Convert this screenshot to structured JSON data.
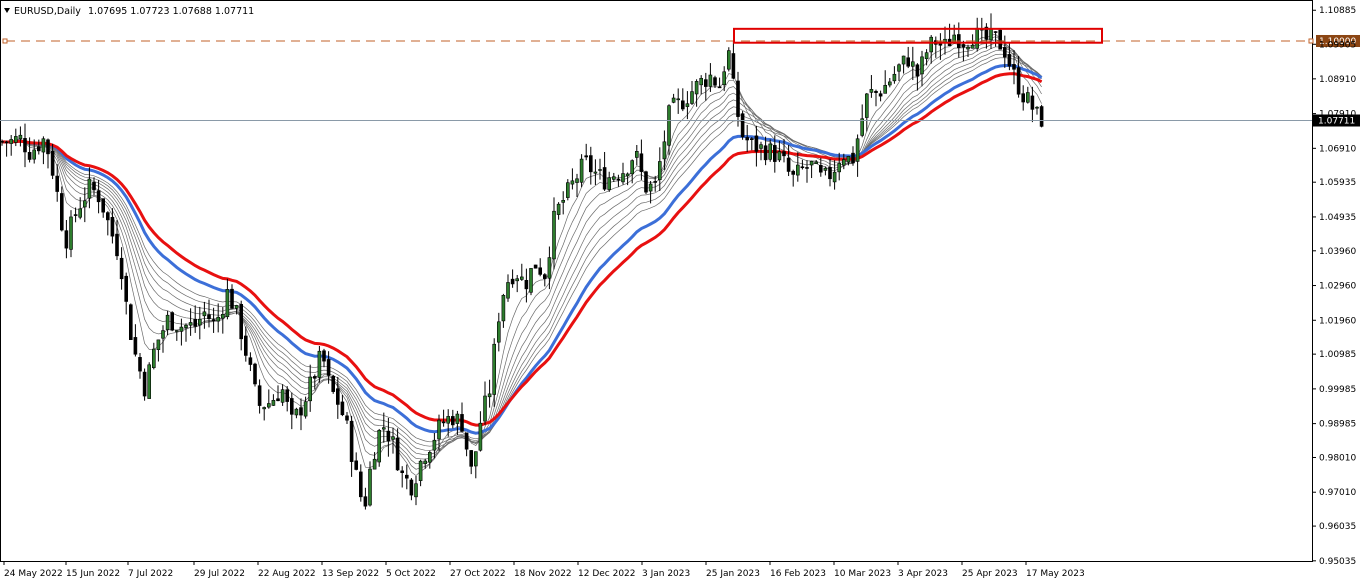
{
  "header": {
    "symbol_timeframe": "EURUSD,Daily",
    "ohlc": "1.07695 1.07723 1.07688 1.07711",
    "menu_icon": "triangle-down-icon"
  },
  "chart_data": {
    "type": "candlestick",
    "title": "EURUSD,Daily",
    "y_ticks": [
      "1.10885",
      "1.09905",
      "1.08910",
      "1.07910",
      "1.06910",
      "1.05935",
      "1.04935",
      "1.03960",
      "1.02960",
      "1.01960",
      "1.00985",
      "0.99985",
      "0.98985",
      "0.98010",
      "0.97010",
      "0.96035",
      "0.95035"
    ],
    "y_range": [
      0.9503,
      1.1118
    ],
    "x_ticks": [
      "24 May 2022",
      "15 Jun 2022",
      "7 Jul 2022",
      "29 Jul 2022",
      "22 Aug 2022",
      "13 Sep 2022",
      "5 Oct 2022",
      "27 Oct 2022",
      "18 Nov 2022",
      "12 Dec 2022",
      "3 Jan 2023",
      "25 Jan 2023",
      "16 Feb 2023",
      "10 Mar 2023",
      "3 Apr 2023",
      "25 Apr 2023",
      "17 May 2023"
    ],
    "current_price": "1.07711",
    "level_line": {
      "price": 1.1,
      "label": "1.10000",
      "style": "dashed",
      "color": "#c0622a"
    },
    "resistance_zone": {
      "price_high": 1.1035,
      "price_low": 1.0995,
      "from": "25 Jan 2023",
      "to": "early Jun 2023",
      "color": "#e00000"
    },
    "moving_averages": [
      {
        "role": "slow-red",
        "color": "#e81010"
      },
      {
        "role": "slow-blue",
        "color": "#3c6fd8"
      },
      {
        "role": "ribbon",
        "color": "#555555"
      }
    ],
    "close_path": [
      [
        0,
        1.071
      ],
      [
        10,
        1.071
      ],
      [
        20,
        1.072
      ],
      [
        30,
        1.068
      ],
      [
        45,
        1.072
      ],
      [
        55,
        1.06
      ],
      [
        65,
        1.042
      ],
      [
        78,
        1.052
      ],
      [
        90,
        1.058
      ],
      [
        100,
        1.055
      ],
      [
        110,
        1.046
      ],
      [
        120,
        1.038
      ],
      [
        128,
        1.02
      ],
      [
        135,
        1.01
      ],
      [
        145,
        1.0
      ],
      [
        155,
        1.012
      ],
      [
        168,
        1.02
      ],
      [
        180,
        1.018
      ],
      [
        195,
        1.018
      ],
      [
        205,
        1.022
      ],
      [
        215,
        1.018
      ],
      [
        228,
        1.028
      ],
      [
        238,
        1.02
      ],
      [
        248,
        1.008
      ],
      [
        258,
        0.995
      ],
      [
        270,
        0.996
      ],
      [
        282,
        1.0
      ],
      [
        292,
        0.99
      ],
      [
        302,
        0.995
      ],
      [
        312,
        1.002
      ],
      [
        322,
        1.01
      ],
      [
        330,
        1.0
      ],
      [
        338,
        0.996
      ],
      [
        346,
        0.99
      ],
      [
        356,
        0.975
      ],
      [
        364,
        0.965
      ],
      [
        372,
        0.98
      ],
      [
        382,
        0.99
      ],
      [
        392,
        0.985
      ],
      [
        402,
        0.975
      ],
      [
        412,
        0.972
      ],
      [
        422,
        0.98
      ],
      [
        432,
        0.985
      ],
      [
        442,
        0.99
      ],
      [
        452,
        0.992
      ],
      [
        462,
        0.99
      ],
      [
        472,
        0.975
      ],
      [
        480,
        0.99
      ],
      [
        490,
        1.0
      ],
      [
        498,
        1.02
      ],
      [
        505,
        1.03
      ],
      [
        515,
        1.034
      ],
      [
        525,
        1.03
      ],
      [
        535,
        1.036
      ],
      [
        545,
        1.033
      ],
      [
        555,
        1.05
      ],
      [
        565,
        1.055
      ],
      [
        575,
        1.06
      ],
      [
        585,
        1.065
      ],
      [
        595,
        1.062
      ],
      [
        605,
        1.06
      ],
      [
        615,
        1.062
      ],
      [
        625,
        1.063
      ],
      [
        635,
        1.068
      ],
      [
        645,
        1.058
      ],
      [
        655,
        1.058
      ],
      [
        662,
        1.068
      ],
      [
        670,
        1.08
      ],
      [
        680,
        1.082
      ],
      [
        690,
        1.085
      ],
      [
        700,
        1.088
      ],
      [
        710,
        1.09
      ],
      [
        720,
        1.087
      ],
      [
        728,
        1.098
      ],
      [
        735,
        1.083
      ],
      [
        742,
        1.073
      ],
      [
        752,
        1.07
      ],
      [
        762,
        1.069
      ],
      [
        772,
        1.068
      ],
      [
        782,
        1.066
      ],
      [
        792,
        1.06
      ],
      [
        802,
        1.063
      ],
      [
        812,
        1.064
      ],
      [
        822,
        1.06
      ],
      [
        832,
        1.062
      ],
      [
        842,
        1.068
      ],
      [
        852,
        1.065
      ],
      [
        860,
        1.075
      ],
      [
        868,
        1.085
      ],
      [
        878,
        1.085
      ],
      [
        888,
        1.088
      ],
      [
        898,
        1.092
      ],
      [
        908,
        1.095
      ],
      [
        918,
        1.09
      ],
      [
        928,
        1.098
      ],
      [
        936,
        1.1
      ],
      [
        944,
        1.098
      ],
      [
        954,
        1.102
      ],
      [
        964,
        1.1
      ],
      [
        974,
        1.102
      ],
      [
        984,
        1.1
      ],
      [
        994,
        1.101
      ],
      [
        1004,
        1.098
      ],
      [
        1014,
        1.09
      ],
      [
        1022,
        1.085
      ],
      [
        1030,
        1.082
      ],
      [
        1038,
        1.078
      ],
      [
        1045,
        1.077
      ]
    ]
  }
}
